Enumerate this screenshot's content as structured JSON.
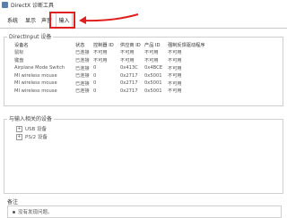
{
  "window": {
    "title": "DirectX 诊断工具"
  },
  "tabs": [
    {
      "label": "系统",
      "active": false
    },
    {
      "label": "显示",
      "active": false
    },
    {
      "label": "声音",
      "active": false
    },
    {
      "label": "输入",
      "active": true
    }
  ],
  "directinput": {
    "group_label": "DirectInput 设备",
    "columns": [
      "设备名",
      "状态",
      "控制器 ID",
      "供应商 ID",
      "产品 ID",
      "强制反馈驱动程序"
    ],
    "rows": [
      [
        "鼠标",
        "已连接",
        "不可用",
        "不可用",
        "不可用",
        "不可用"
      ],
      [
        "键盘",
        "已连接",
        "不可用",
        "不可用",
        "不可用",
        "不可用"
      ],
      [
        "Airplane Mode Switch",
        "已连接",
        "0",
        "0x413C",
        "0x4BCE",
        "不可用"
      ],
      [
        "MI wireless mouse",
        "已连接",
        "0",
        "0x2717",
        "0x5001",
        "不可用"
      ],
      [
        "MI wireless mouse",
        "已连接",
        "0",
        "0x2717",
        "0x5001",
        "不可用"
      ],
      [
        "MI wireless mouse",
        "已连接",
        "0",
        "0x2717",
        "0x5001",
        "不可用"
      ]
    ]
  },
  "related": {
    "group_label": "与输入相关的设备",
    "items": [
      {
        "expander": "+",
        "label": "USB 设备"
      },
      {
        "expander": "+",
        "label": "PS/2 设备"
      }
    ]
  },
  "notes": {
    "label": "备注",
    "items": [
      "没有发现问题。"
    ]
  },
  "colors": {
    "highlight": "#e02020",
    "border": "#d0d0d0"
  }
}
